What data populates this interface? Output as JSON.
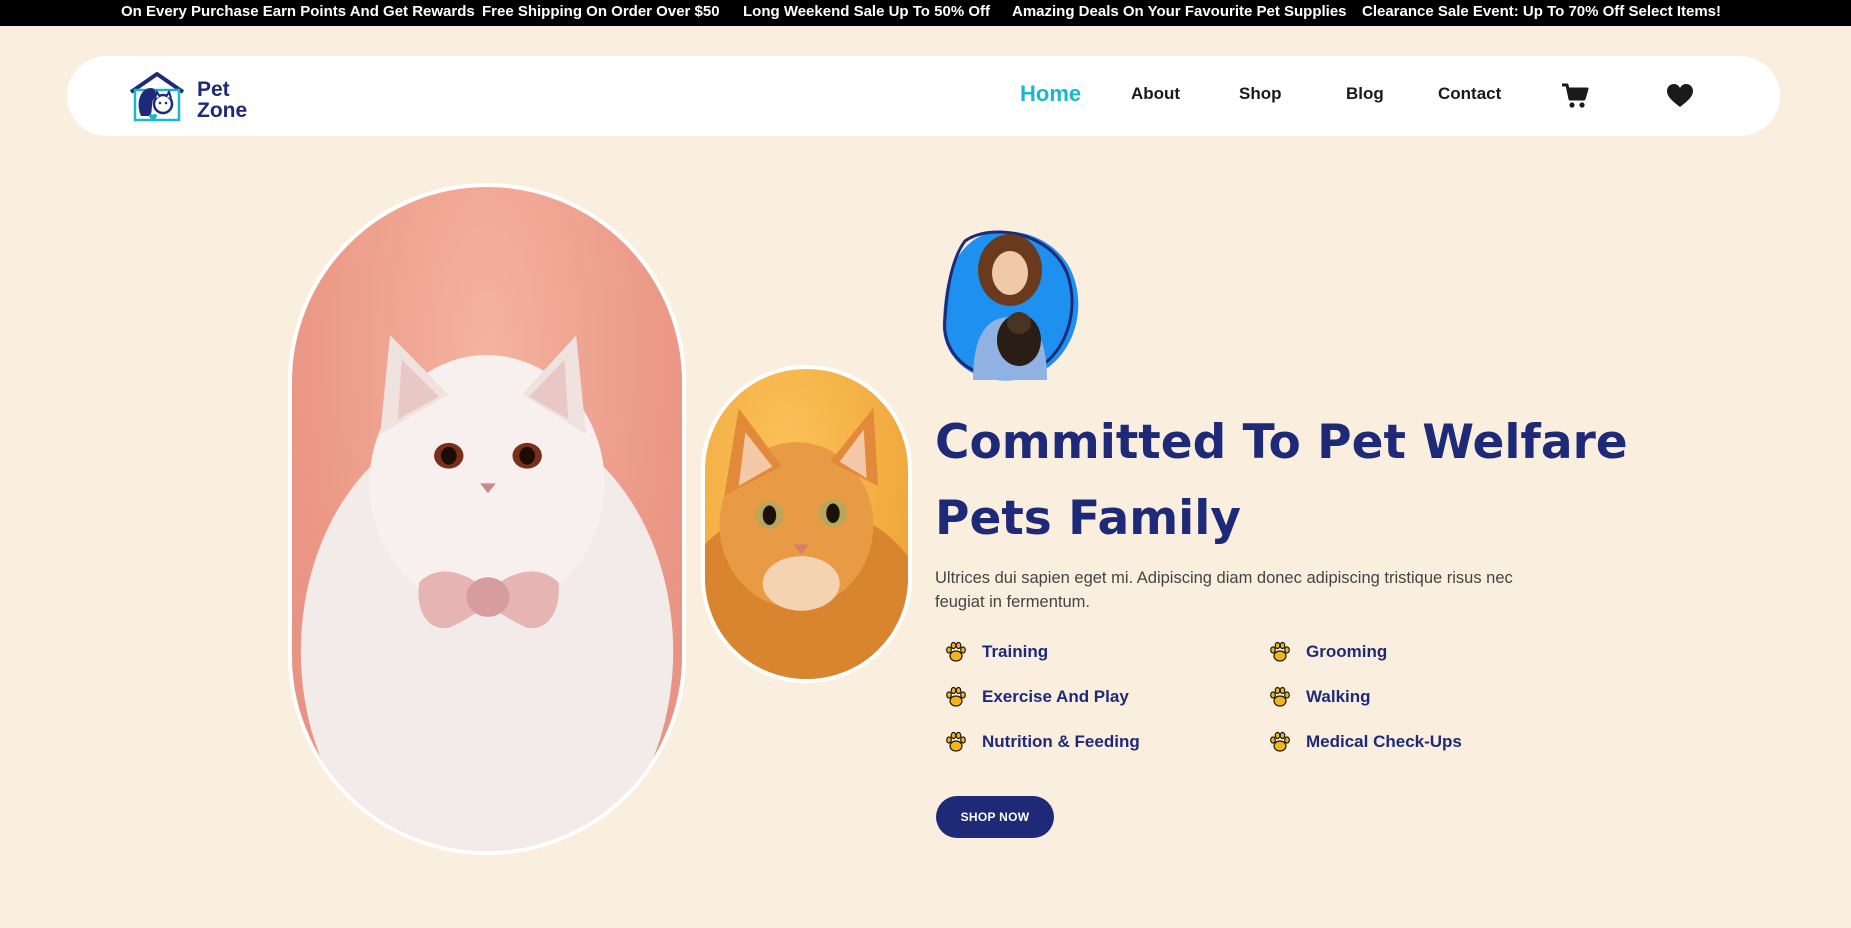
{
  "announcements": [
    "On Every Purchase Earn Points And Get Rewards",
    "Free Shipping On Order Over $50",
    "Long Weekend Sale Up To 50% Off",
    "Amazing Deals On Your Favourite Pet Supplies",
    "Clearance Sale Event: Up To 70% Off Select Items!"
  ],
  "brand": {
    "line1": "Pet",
    "line2": "Zone"
  },
  "nav": {
    "links": [
      "Home",
      "About",
      "Shop",
      "Blog",
      "Contact"
    ],
    "active": "Home",
    "icons": [
      "cart-icon",
      "heart-icon"
    ]
  },
  "hero": {
    "title_line1": "Committed To Pet Welfare",
    "title_line2": "Pets Family",
    "description": "Ultrices dui sapien eget mi. Adipiscing diam donec adipiscing tristique risus nec feugiat in fermentum.",
    "features": [
      "Training",
      "Grooming",
      "Exercise And Play",
      "Walking",
      "Nutrition & Feeding",
      "Medical Check-Ups"
    ],
    "cta": "SHOP NOW"
  },
  "colors": {
    "background": "#faefdf",
    "navy": "#1e2a78",
    "teal_active": "#15b9c9",
    "paw_yellow": "#f5b417"
  }
}
